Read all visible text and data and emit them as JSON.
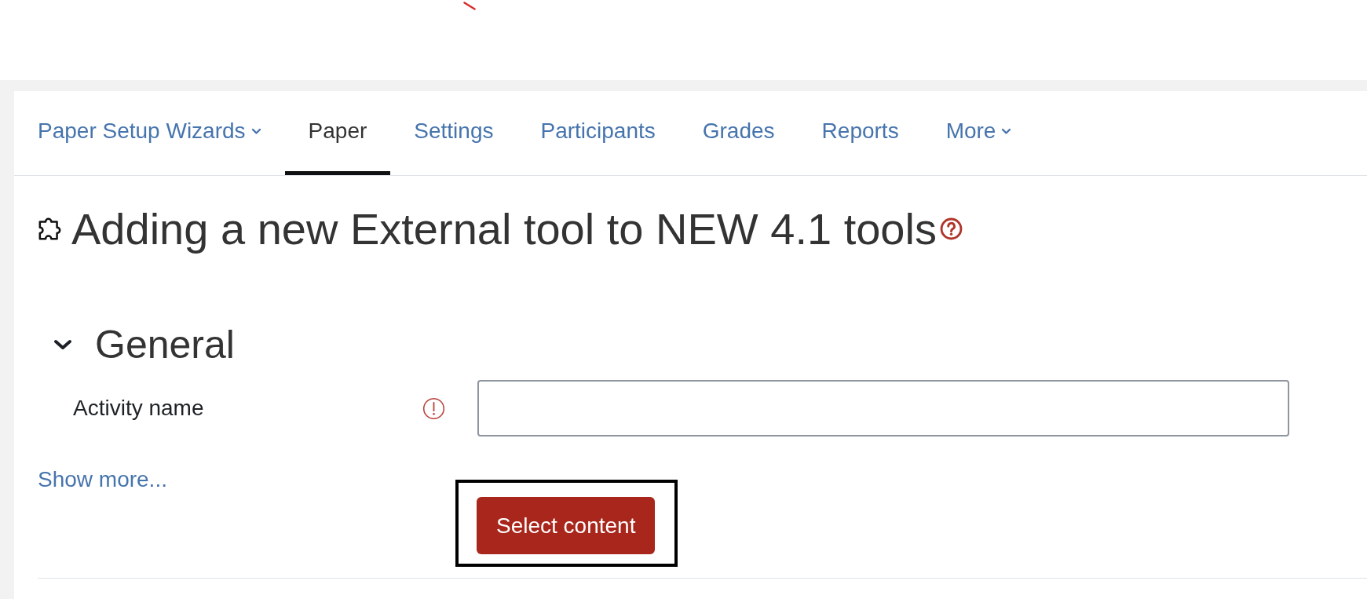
{
  "nav_tabs": [
    {
      "label": "Paper Setup Wizards",
      "kind": "dropdown",
      "selected": false
    },
    {
      "label": "Paper",
      "kind": "link",
      "selected": true
    },
    {
      "label": "Settings",
      "kind": "link",
      "selected": false
    },
    {
      "label": "Participants",
      "kind": "link",
      "selected": false
    },
    {
      "label": "Grades",
      "kind": "link",
      "selected": false
    },
    {
      "label": "Reports",
      "kind": "link",
      "selected": false
    },
    {
      "label": "More",
      "kind": "dropdown",
      "selected": false
    }
  ],
  "page_heading": {
    "title": "Adding a new External tool to NEW 4.1 tools"
  },
  "form": {
    "sections": [
      {
        "title": "General",
        "expanded": true,
        "fields": [
          {
            "label": "Activity name",
            "required": true
          }
        ]
      }
    ],
    "show_more_link": "Show more...",
    "select_content_button": "Select content"
  }
}
